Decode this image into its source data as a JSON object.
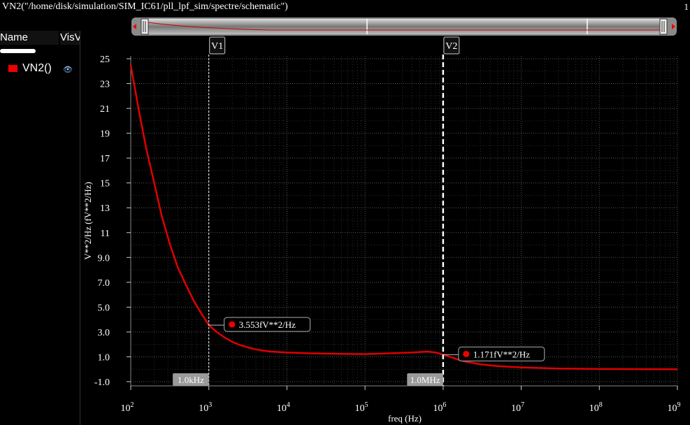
{
  "window": {
    "title": "VN2(\"/home/disk/simulation/SIM_IC61/pll_lpf_sim/spectre/schematic\")",
    "subwindow_number": "1"
  },
  "legend": {
    "col_name": "Name",
    "col_vis": "Vis",
    "col_vis_overflow": "V",
    "traces": [
      {
        "label": "VN2()",
        "color": "#e00000",
        "visible_icon": "eye-icon"
      }
    ]
  },
  "markers": [
    {
      "name": "V1",
      "x": 1000
    },
    {
      "name": "V2",
      "x": 1000000
    }
  ],
  "marker_badges": [
    {
      "label": "1.0kHz",
      "x": 1000
    },
    {
      "label": "1.0MHz",
      "x": 1000000
    }
  ],
  "point_labels": [
    {
      "text": "3.553fV**2/Hz",
      "x": 1000,
      "y": 3.553
    },
    {
      "text": "1.171fV**2/Hz",
      "x": 1000000,
      "y": 1.171
    }
  ],
  "chart_data": {
    "type": "line",
    "title": "",
    "xlabel": "freq (Hz)",
    "ylabel": "V**2/Hz (fV**2/Hz)",
    "xscale": "log",
    "xlim": [
      100,
      1000000000
    ],
    "ylim": [
      -2.0,
      25
    ],
    "grid": true,
    "background": "#000000",
    "yticks": [
      "25",
      "23",
      "21",
      "19",
      "17",
      "15",
      "13",
      "11",
      "9.0",
      "7.0",
      "5.0",
      "3.0",
      "1.0",
      "-1.0"
    ],
    "ytick_values": [
      25,
      23,
      21,
      19,
      17,
      15,
      13,
      11,
      9,
      7,
      5,
      3,
      1,
      -1
    ],
    "xtick_mantissa": "10",
    "xtick_exponents": [
      "2",
      "3",
      "4",
      "5",
      "6",
      "7",
      "8",
      "9"
    ],
    "series": [
      {
        "name": "VN2()",
        "color": "#e00000",
        "points": [
          [
            100,
            24.5
          ],
          [
            130,
            20.5
          ],
          [
            160,
            17.6
          ],
          [
            200,
            15.0
          ],
          [
            250,
            12.3
          ],
          [
            320,
            10.0
          ],
          [
            400,
            8.2
          ],
          [
            500,
            6.9
          ],
          [
            630,
            5.6
          ],
          [
            800,
            4.5
          ],
          [
            1000,
            3.553
          ],
          [
            1260,
            3.0
          ],
          [
            1600,
            2.55
          ],
          [
            2000,
            2.2
          ],
          [
            2500,
            1.95
          ],
          [
            3200,
            1.75
          ],
          [
            4000,
            1.6
          ],
          [
            5000,
            1.5
          ],
          [
            6300,
            1.42
          ],
          [
            10000,
            1.35
          ],
          [
            20000,
            1.28
          ],
          [
            50000,
            1.24
          ],
          [
            100000,
            1.22
          ],
          [
            200000,
            1.28
          ],
          [
            400000,
            1.35
          ],
          [
            630000,
            1.42
          ],
          [
            800000,
            1.35
          ],
          [
            1000000,
            1.171
          ],
          [
            1300000,
            0.95
          ],
          [
            1600000,
            0.75
          ],
          [
            2000000,
            0.6
          ],
          [
            3000000,
            0.4
          ],
          [
            5000000,
            0.25
          ],
          [
            10000000,
            0.15
          ],
          [
            30000000,
            0.05
          ],
          [
            100000000,
            0.02
          ],
          [
            1000000000,
            0.0
          ]
        ]
      }
    ]
  }
}
